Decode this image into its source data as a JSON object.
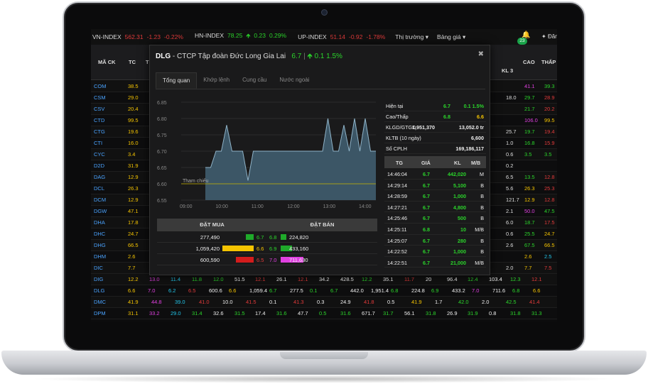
{
  "topbar": {
    "indices": [
      {
        "name": "VN-INDEX",
        "value": "562.31",
        "change": "-1.23",
        "pct": "-0.22%",
        "color": "red"
      },
      {
        "name": "HN-INDEX",
        "value": "78.25",
        "change": "0.23",
        "pct": "0.29%",
        "color": "green"
      },
      {
        "name": "UP-INDEX",
        "value": "51.14",
        "change": "-0.92",
        "pct": "-1.78%",
        "color": "red"
      }
    ],
    "menu_market": "Thị trường",
    "menu_board": "Bảng giá",
    "notif_count": "23",
    "login_label": "Đăn"
  },
  "board": {
    "headers": {
      "symbol": "MÃ CK",
      "ref": "TC",
      "t": "T",
      "kl3": "KL 3",
      "high": "CAO",
      "low": "THẤP"
    },
    "rows": [
      {
        "sym": "COM",
        "tc": "38.5",
        "kl3": "",
        "cao": "41.1",
        "thap": "39.3",
        "cao_c": "purple",
        "thap_c": "green"
      },
      {
        "sym": "CSM",
        "tc": "29.0",
        "kl3": "18.0",
        "cao": "29.7",
        "thap": "28.9",
        "cao_c": "green",
        "thap_c": "red"
      },
      {
        "sym": "CSV",
        "tc": "20.4",
        "kl3": "",
        "cao": "21.7",
        "thap": "20.2",
        "cao_c": "green",
        "thap_c": "red"
      },
      {
        "sym": "CTD",
        "tc": "99.5",
        "kl3": "",
        "cao": "106.0",
        "thap": "99.5",
        "cao_c": "purple",
        "thap_c": "yellow"
      },
      {
        "sym": "CTG",
        "tc": "19.6",
        "kl3": "25.7",
        "cao": "19.7",
        "thap": "19.4",
        "cao_c": "green",
        "thap_c": "red"
      },
      {
        "sym": "CTI",
        "tc": "16.0",
        "kl3": "1.0",
        "cao": "16.8",
        "thap": "15.9",
        "cao_c": "green",
        "thap_c": "red"
      },
      {
        "sym": "CYC",
        "tc": "3.4",
        "kl3": "0.6",
        "cao": "3.5",
        "thap": "3.5",
        "cao_c": "green",
        "thap_c": "green"
      },
      {
        "sym": "D2D",
        "tc": "31.9",
        "kl3": "0.2",
        "cao": "",
        "thap": "",
        "cao_c": "green",
        "thap_c": "green"
      },
      {
        "sym": "DAG",
        "tc": "12.9",
        "kl3": "6.5",
        "cao": "13.5",
        "thap": "12.8",
        "cao_c": "green",
        "thap_c": "red"
      },
      {
        "sym": "DCL",
        "tc": "26.3",
        "kl3": "5.6",
        "cao": "26.3",
        "thap": "25.3",
        "cao_c": "yellow",
        "thap_c": "red"
      },
      {
        "sym": "DCM",
        "tc": "12.9",
        "kl3": "121.7",
        "cao": "12.9",
        "thap": "12.8",
        "cao_c": "yellow",
        "thap_c": "red"
      },
      {
        "sym": "DGW",
        "tc": "47.1",
        "kl3": "2.1",
        "cao": "50.0",
        "thap": "47.5",
        "cao_c": "purple",
        "thap_c": "green"
      },
      {
        "sym": "DHA",
        "tc": "17.8",
        "kl3": "6.0",
        "cao": "18.7",
        "thap": "17.5",
        "cao_c": "green",
        "thap_c": "red"
      },
      {
        "sym": "DHC",
        "tc": "24.7",
        "kl3": "0.6",
        "cao": "25.5",
        "thap": "24.7",
        "cao_c": "green",
        "thap_c": "yellow"
      },
      {
        "sym": "DHG",
        "tc": "66.5",
        "kl3": "2.6",
        "cao": "67.5",
        "thap": "66.5",
        "cao_c": "green",
        "thap_c": "yellow"
      },
      {
        "sym": "DHM",
        "tc": "2.6",
        "kl3": "",
        "cao": "2.6",
        "thap": "2.5",
        "cao_c": "yellow",
        "thap_c": "cyan"
      },
      {
        "sym": "DIC",
        "tc": "7.7",
        "kl3": "2.0",
        "cao": "7.7",
        "thap": "7.5",
        "cao_c": "yellow",
        "thap_c": "red"
      }
    ],
    "bottom_rows": [
      {
        "sym": "DIG",
        "cells": [
          "12.2",
          "13.0",
          "11.4",
          "11.8",
          "12.0",
          "51.5",
          "12.1",
          "26.1",
          "12.1",
          "34.2",
          "428.5",
          "12.2",
          "35.1",
          "11.7",
          "20",
          "96.4",
          "12.4",
          "103.4",
          "12.3",
          "12.1"
        ],
        "colors": [
          "yellow",
          "purple",
          "cyan",
          "green",
          "green",
          "white",
          "red",
          "white",
          "red",
          "white",
          "white",
          "green",
          "white",
          "red",
          "white",
          "white",
          "green",
          "white",
          "green",
          "red"
        ]
      },
      {
        "sym": "DLG",
        "cells": [
          "6.6",
          "7.0",
          "6.2",
          "6.5",
          "600.6",
          "6.6",
          "1,059.4",
          "6.7",
          "277.5",
          "0.1",
          "6.7",
          "442.0",
          "1,951.4",
          "6.8",
          "224.8",
          "6.9",
          "433.2",
          "7.0",
          "711.6",
          "6.8",
          "6.6"
        ],
        "colors": [
          "yellow",
          "purple",
          "cyan",
          "red",
          "white",
          "yellow",
          "white",
          "green",
          "white",
          "green",
          "green",
          "white",
          "white",
          "green",
          "white",
          "green",
          "white",
          "purple",
          "white",
          "green",
          "yellow"
        ]
      },
      {
        "sym": "DMC",
        "cells": [
          "41.9",
          "44.8",
          "39.0",
          "41.0",
          "10.0",
          "41.5",
          "0.1",
          "41.3",
          "0.3",
          "24.9",
          "41.8",
          "0.5",
          "41.9",
          "1.7",
          "42.0",
          "2.0",
          "42.5",
          "41.4"
        ],
        "colors": [
          "yellow",
          "purple",
          "cyan",
          "red",
          "white",
          "red",
          "white",
          "red",
          "white",
          "white",
          "red",
          "white",
          "yellow",
          "white",
          "green",
          "white",
          "green",
          "red"
        ]
      },
      {
        "sym": "DPM",
        "cells": [
          "31.1",
          "33.2",
          "29.0",
          "31.4",
          "32.6",
          "31.5",
          "17.4",
          "31.6",
          "47.7",
          "0.5",
          "31.6",
          "671.7",
          "31.7",
          "56.1",
          "31.8",
          "26.9",
          "31.9",
          "0.8",
          "31.8",
          "31.3"
        ],
        "colors": [
          "yellow",
          "purple",
          "cyan",
          "green",
          "white",
          "green",
          "white",
          "green",
          "white",
          "green",
          "green",
          "white",
          "green",
          "white",
          "green",
          "white",
          "green",
          "white",
          "green",
          "green"
        ]
      }
    ]
  },
  "modal": {
    "symbol": "DLG",
    "company": "CTCP Tập đoàn Đức Long Gia Lai",
    "price": "6.7",
    "change": "0.1",
    "change_pct": "1.5%",
    "close_label": "✖",
    "tabs": [
      "Tổng quan",
      "Khớp lệnh",
      "Cung cầu",
      "Nước ngoài"
    ],
    "active_tab": 0,
    "ref_label": "Tham chiếu",
    "stats": [
      {
        "label": "Hiện tại",
        "v1": "6.7",
        "v2": "0.1  1.5%",
        "c1": "green",
        "c2": "green"
      },
      {
        "label": "Cao/Thấp",
        "v1": "6.8",
        "v2": "6.6",
        "c1": "green",
        "c2": "yellow"
      },
      {
        "label": "KLGD/GTGD",
        "v1": "1,951,370",
        "v2": "13,052.0 tr",
        "c1": "white",
        "c2": "white"
      },
      {
        "label": "KLTB (10 ngày)",
        "v1": "",
        "v2": "6,600",
        "c1": "white",
        "c2": "white"
      },
      {
        "label": "Số CPLH",
        "v1": "",
        "v2": "169,186,117",
        "c1": "white",
        "c2": "white"
      }
    ],
    "order_book": {
      "buy_label": "ĐẶT MUA",
      "sell_label": "ĐẶT BÁN",
      "rows": [
        {
          "buy_vol": "277,490",
          "buy_price": "6.7",
          "buy_color": "#1faa2a",
          "buy_frac": 0.26,
          "sell_price": "6.8",
          "sell_vol": "224,820",
          "sell_color": "#1faa2a",
          "sell_frac": 0.05,
          "bp_c": "green",
          "sp_c": "green"
        },
        {
          "buy_vol": "1,059,420",
          "buy_price": "6.6",
          "buy_color": "#f5c400",
          "buy_frac": 1.0,
          "sell_price": "6.9",
          "sell_vol": "433,160",
          "sell_color": "#1faa2a",
          "sell_frac": 0.1,
          "bp_c": "yellow",
          "sp_c": "green"
        },
        {
          "buy_vol": "600,590",
          "buy_price": "6.5",
          "buy_color": "#d41c1c",
          "buy_frac": 0.57,
          "sell_price": "7.0",
          "sell_vol": "711,630",
          "sell_color": "#e040e0",
          "sell_frac": 0.2,
          "bp_c": "red",
          "sp_c": "purple"
        }
      ]
    },
    "matches": {
      "headers": [
        "TG",
        "GIÁ",
        "KL",
        "M/B"
      ],
      "rows": [
        {
          "t": "14:46:04",
          "p": "6.7",
          "v": "442,020",
          "mb": "M"
        },
        {
          "t": "14:29:14",
          "p": "6.7",
          "v": "5,100",
          "mb": "B"
        },
        {
          "t": "14:28:59",
          "p": "6.7",
          "v": "1,000",
          "mb": "B"
        },
        {
          "t": "14:27:21",
          "p": "6.7",
          "v": "4,800",
          "mb": "B"
        },
        {
          "t": "14:25:46",
          "p": "6.7",
          "v": "500",
          "mb": "B"
        },
        {
          "t": "14:25:11",
          "p": "6.8",
          "v": "10",
          "mb": "M/B"
        },
        {
          "t": "14:25:07",
          "p": "6.7",
          "v": "280",
          "mb": "B"
        },
        {
          "t": "14:22:52",
          "p": "6.7",
          "v": "1,000",
          "mb": "B"
        },
        {
          "t": "14:22:51",
          "p": "6.7",
          "v": "21,000",
          "mb": "M/B"
        }
      ]
    }
  },
  "chart_data": {
    "type": "area",
    "yticks": [
      "6.85",
      "6.80",
      "6.75",
      "6.70",
      "6.65",
      "6.60",
      "6.55"
    ],
    "ylim": [
      6.55,
      6.85
    ],
    "xticks": [
      "09:00",
      "10:00",
      "11:00",
      "12:00",
      "13:00",
      "14:00"
    ],
    "reference": 6.6,
    "series": [
      {
        "values": [
          6.65,
          6.65,
          6.7,
          6.7,
          6.78,
          6.7,
          6.7,
          6.7,
          6.61,
          6.7,
          6.7,
          6.7,
          6.7,
          6.7,
          6.7,
          6.7,
          6.7,
          6.7,
          6.7,
          6.7,
          6.7,
          6.7,
          6.7,
          6.8,
          6.7,
          6.7,
          6.78,
          6.7,
          6.8,
          6.7,
          6.8,
          6.7,
          6.7
        ]
      }
    ]
  }
}
